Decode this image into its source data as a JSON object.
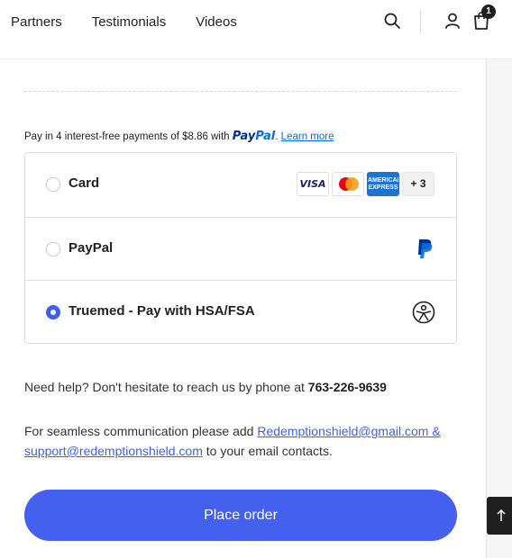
{
  "nav": {
    "items": [
      "Partners",
      "Testimonials",
      "Videos"
    ]
  },
  "header": {
    "cart_count": "1"
  },
  "paypal_message": {
    "prefix": "Pay in 4 interest-free payments of $8.86 with",
    "logo_pay": "Pay",
    "logo_pal": "Pal",
    "suffix": ".",
    "learn_more": "Learn more"
  },
  "payment_methods": [
    {
      "label": "Card",
      "selected": false
    },
    {
      "label": "PayPal",
      "selected": false
    },
    {
      "label": "Truemed - Pay with HSA/FSA",
      "selected": true
    }
  ],
  "card_brands": {
    "visa": "VISA",
    "amex_line1": "AMERICAN",
    "amex_line2": "EXPRESS",
    "more": "+ 3"
  },
  "help": {
    "text": "Need help? Don't hesitate to reach us by phone at",
    "phone": "763-226-9639"
  },
  "contact": {
    "prefix": "For seamless communication please add",
    "emails": "Redemptionshield@gmail.com & support@redemptionshield.com",
    "suffix": "to your email contacts."
  },
  "place_order_label": "Place order",
  "colors": {
    "accent": "#4360ee",
    "paypal_dark": "#003087",
    "paypal_light": "#0070e0"
  }
}
